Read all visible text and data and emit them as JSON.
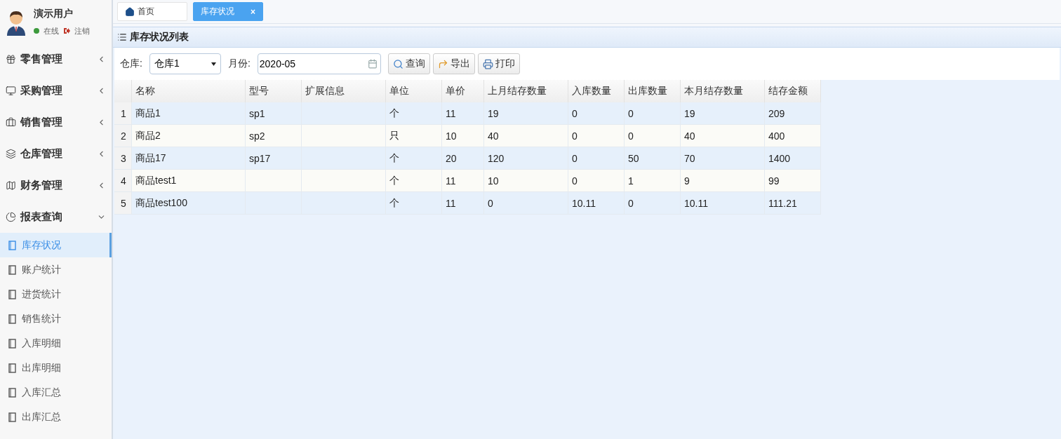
{
  "sidebar": {
    "user": {
      "name": "演示用户",
      "online": true,
      "status_label": "在线",
      "logout_label": "注销"
    },
    "menu": [
      {
        "label": "零售管理",
        "kind": "gift",
        "expanded": false
      },
      {
        "label": "采购管理",
        "kind": "monitor",
        "expanded": false
      },
      {
        "label": "销售管理",
        "kind": "briefcase",
        "expanded": false
      },
      {
        "label": "仓库管理",
        "kind": "layers",
        "expanded": false
      },
      {
        "label": "财务管理",
        "kind": "map",
        "expanded": false
      },
      {
        "label": "报表查询",
        "kind": "pie",
        "expanded": true,
        "children": [
          {
            "label": "库存状况",
            "selected": true
          },
          {
            "label": "账户统计",
            "selected": false
          },
          {
            "label": "进货统计",
            "selected": false
          },
          {
            "label": "销售统计",
            "selected": false
          },
          {
            "label": "入库明细",
            "selected": false
          },
          {
            "label": "出库明细",
            "selected": false
          },
          {
            "label": "入库汇总",
            "selected": false
          },
          {
            "label": "出库汇总",
            "selected": false
          }
        ]
      }
    ]
  },
  "tabs": [
    {
      "label": "首页",
      "kind": "home",
      "selected": false
    },
    {
      "label": "库存状况",
      "kind": "page",
      "selected": true,
      "close": "×"
    }
  ],
  "panel": {
    "title": "库存状况列表"
  },
  "toolbar": {
    "warehouse_label": "仓库:",
    "warehouse": "仓库1",
    "month_label": "月份:",
    "month": "2020-05",
    "buttons": [
      {
        "label": "查询",
        "kind": "search"
      },
      {
        "label": "导出",
        "kind": "export"
      },
      {
        "label": "打印",
        "kind": "print"
      }
    ]
  },
  "table": {
    "columns": [
      "名称",
      "型号",
      "扩展信息",
      "单位",
      "单价",
      "上月结存数量",
      "入库数量",
      "出库数量",
      "本月结存数量",
      "结存金额"
    ],
    "rows": [
      {
        "number": "1",
        "cells": [
          "商品1",
          "sp1",
          "",
          "个",
          "11",
          "19",
          "0",
          "0",
          "19",
          "209"
        ]
      },
      {
        "number": "2",
        "cells": [
          "商品2",
          "sp2",
          "",
          "只",
          "10",
          "40",
          "0",
          "0",
          "40",
          "400"
        ]
      },
      {
        "number": "3",
        "cells": [
          "商品17",
          "sp17",
          "",
          "个",
          "20",
          "120",
          "0",
          "50",
          "70",
          "1400"
        ]
      },
      {
        "number": "4",
        "cells": [
          "商品test1",
          "",
          "",
          "个",
          "11",
          "10",
          "0",
          "1",
          "9",
          "99"
        ]
      },
      {
        "number": "5",
        "cells": [
          "商品test100",
          "",
          "",
          "个",
          "11",
          "0",
          "10.11",
          "0",
          "10.11",
          "111.21"
        ]
      }
    ]
  }
}
